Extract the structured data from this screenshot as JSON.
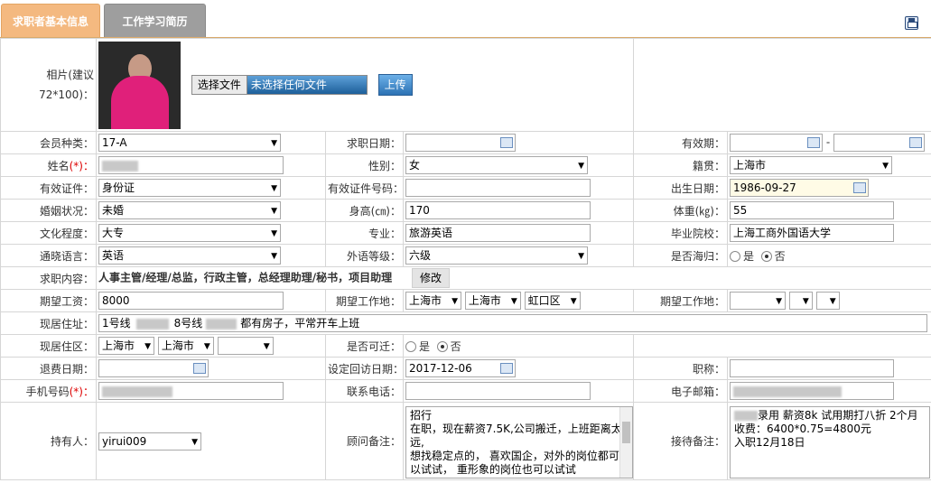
{
  "tabs": [
    {
      "label": "求职者基本信息"
    },
    {
      "label": "工作学习简历"
    }
  ],
  "photo": {
    "label_line1": "相片(建议",
    "label_line2": "72*100)：",
    "choose_file": "选择文件",
    "no_file": "未选择任何文件",
    "upload": "上传"
  },
  "labels": {
    "member_type": "会员种类：",
    "apply_date": "求职日期：",
    "valid_period": "有效期：",
    "name": "姓名",
    "gender": "性别：",
    "native": "籍贯：",
    "id_type": "有效证件：",
    "id_number": "有效证件号码：",
    "birth": "出生日期：",
    "marital": "婚姻状况：",
    "height": "身高(㎝)：",
    "weight": "体重(㎏)：",
    "education": "文化程度：",
    "major": "专业：",
    "school": "毕业院校：",
    "language": "通晓语言：",
    "foreign_level": "外语等级：",
    "returnee": "是否海归：",
    "job_content": "求职内容：",
    "salary": "期望工资：",
    "work_place": "期望工作地：",
    "work_place2": "期望工作地：",
    "address": "现居住址：",
    "district": "现居住区：",
    "relocate": "是否可迁：",
    "refund_date": "退费日期：",
    "visit_date": "设定回访日期：",
    "title": "职称：",
    "mobile": "手机号码",
    "phone": "联系电话：",
    "email": "电子邮箱：",
    "holder": "持有人：",
    "advisor_note": "顾问备注：",
    "reception_note": "接待备注："
  },
  "values": {
    "member_type": "17-A",
    "valid_sep": "-",
    "gender": "女",
    "native": "上海市",
    "id_type": "身份证",
    "birth": "1986-09-27",
    "marital": "未婚",
    "height": "170",
    "weight": "55",
    "education": "大专",
    "major": "旅游英语",
    "school": "上海工商外国语大学",
    "language": "英语",
    "foreign_level": "六级",
    "yes": "是",
    "no": "否",
    "job_content": "人事主管/经理/总监，行政主管，总经理助理/秘书，项目助理",
    "modify": "修改",
    "salary": "8000",
    "work_city1": "上海市",
    "work_city2": "上海市",
    "work_district": "虹口区",
    "address_part1": "1号线",
    "address_part2": "8号线",
    "address_part3": "都有房子，平常开车上班",
    "district_city1": "上海市",
    "district_city2": "上海市",
    "visit_date": "2017-12-06",
    "holder": "yirui009",
    "advisor_note": "招行\n在职，现在薪资7.5K,公司搬迁，上班距离太远,\n想找稳定点的， 喜欢国企，对外的岗位都可以试试， 重形象的岗位也可以试试",
    "reception_note_line1": "录用 薪资8k 试用期打八折 2个月",
    "reception_note_line2": "收费：6400*0.75=4800元\n入职12月18日"
  },
  "required_mark": "(*)："
}
